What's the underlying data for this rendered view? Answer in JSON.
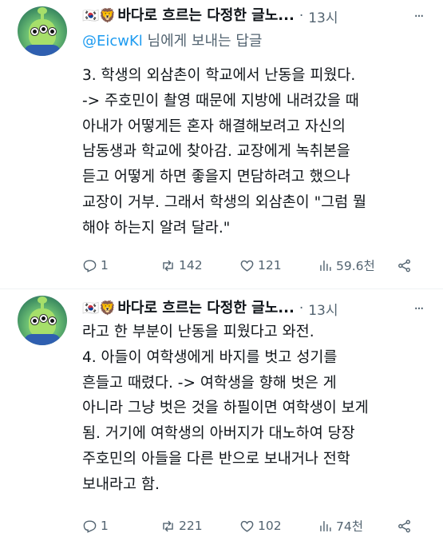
{
  "tweets": [
    {
      "flag": "🇰🇷🦁",
      "author": "바다로 흐르는 다정한 글노...",
      "dot": "·",
      "time": "13시",
      "more": "···",
      "reply_prefix": "@EicwKl",
      "reply_suffix": " 님에게 보내는 답글",
      "lines": [
        "3. 학생의 외삼촌이 학교에서 난동을 피웠다.",
        "-> 주호민이 촬영 때문에 지방에 내려갔을 때",
        "아내가 어떻게든 혼자 해결해보려고 자신의",
        "남동생과 학교에 찾아감.  교장에게 녹취본을",
        "듣고 어떻게 하면 좋을지 면담하려고 했으나",
        "교장이 거부. 그래서 학생의 외삼촌이 \"그럼 뭘",
        "해야 하는지 알려 달라.\""
      ],
      "stats": {
        "replies": "1",
        "retweets": "142",
        "likes": "121",
        "views": "59.6천"
      },
      "icons": {
        "reply": "reply-icon",
        "retweet": "retweet-icon",
        "like": "heart-icon",
        "views": "views-icon",
        "share": "share-icon"
      }
    },
    {
      "flag": "🇰🇷🦁",
      "author": "바다로 흐르는 다정한 글노...",
      "dot": "·",
      "time": "13시",
      "more": "···",
      "lines": [
        "라고 한 부분이 난동을 피웠다고 와전.",
        "4. 아들이 여학생에게 바지를 벗고 성기를",
        "흔들고 때렸다. -> 여학생을 향해 벗은 게",
        "아니라 그냥 벗은 것을 하필이면 여학생이 보게",
        "됨. 거기에 여학생의 아버지가 대노하여 당장",
        "주호민의 아들을 다른 반으로 보내거나 전학",
        "보내라고 함."
      ],
      "stats": {
        "replies": "1",
        "retweets": "221",
        "likes": "102",
        "views": "74천"
      },
      "icons": {
        "reply": "reply-icon",
        "retweet": "retweet-icon",
        "like": "heart-icon",
        "views": "views-icon",
        "share": "share-icon"
      }
    }
  ],
  "colors": {
    "text": "#0f1419",
    "secondary": "#536471",
    "link": "#1d9bf0",
    "divider": "#eff3f4"
  }
}
